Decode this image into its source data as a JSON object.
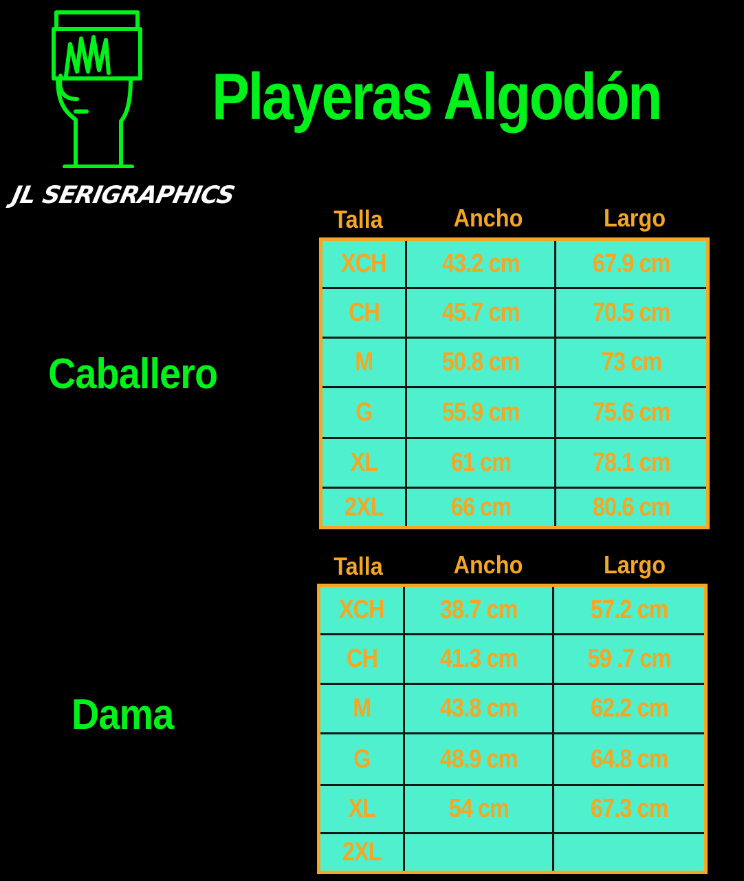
{
  "brand": {
    "name": "JL SERIGRAPHICS",
    "logo_icon": "hand-holding-squeegee-icon",
    "logo_color": "#00f21a"
  },
  "title": "Playeras Algodón",
  "colors": {
    "background": "#000000",
    "title_green": "#00f21a",
    "accent_orange": "#f5a623",
    "table_fill": "#4ff0cd"
  },
  "caballero": {
    "label": "Caballero",
    "headers": [
      "Talla",
      "Ancho",
      "Largo"
    ],
    "rows": [
      {
        "talla": "XCH",
        "ancho": "43.2 cm",
        "largo": "67.9 cm"
      },
      {
        "talla": "CH",
        "ancho": "45.7 cm",
        "largo": "70.5 cm"
      },
      {
        "talla": "M",
        "ancho": "50.8 cm",
        "largo": "73 cm"
      },
      {
        "talla": "G",
        "ancho": "55.9 cm",
        "largo": "75.6 cm"
      },
      {
        "talla": "XL",
        "ancho": "61 cm",
        "largo": "78.1 cm"
      },
      {
        "talla": "2XL",
        "ancho": "66 cm",
        "largo": "80.6 cm"
      }
    ]
  },
  "dama": {
    "label": "Dama",
    "headers": [
      "Talla",
      "Ancho",
      "Largo"
    ],
    "rows": [
      {
        "talla": "XCH",
        "ancho": "38.7 cm",
        "largo": "57.2 cm"
      },
      {
        "talla": "CH",
        "ancho": "41.3 cm",
        "largo": "59 .7 cm"
      },
      {
        "talla": "M",
        "ancho": "43.8 cm",
        "largo": "62.2 cm"
      },
      {
        "talla": "G",
        "ancho": "48.9 cm",
        "largo": "64.8 cm"
      },
      {
        "talla": "XL",
        "ancho": "54 cm",
        "largo": "67.3 cm"
      },
      {
        "talla": "2XL",
        "ancho": "",
        "largo": ""
      }
    ]
  }
}
